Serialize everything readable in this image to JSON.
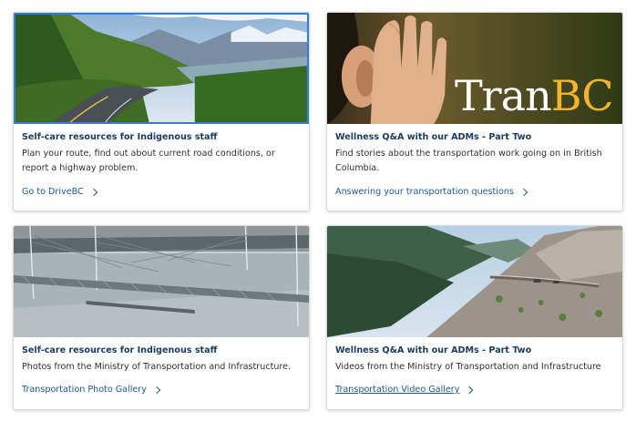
{
  "cards": [
    {
      "title": "Self-care resources for Indigenous staff",
      "description": "Plan your route, find out about current road conditions, or report a highway problem.",
      "link_label": "Go to DriveBC",
      "image": "mountain-highway-photo"
    },
    {
      "title": "Wellness Q&A with our ADMs - Part Two",
      "description": "Find stories about the transportation work going on in British Columbia.",
      "link_label": "Answering your transportation questions",
      "image": "tranbc-ear-photo",
      "logo_text_1": "Tran",
      "logo_text_2": "BC"
    },
    {
      "title": "Self-care resources for Indigenous staff",
      "description": "Photos from the Ministry of Transportation and Infrastructure.",
      "link_label": "Transportation Photo Gallery",
      "image": "bridge-construction-photo"
    },
    {
      "title": "Wellness Q&A with our ADMs - Part Two",
      "description": "Videos from the Ministry of Transportation and Infrastructure",
      "link_label": "Transportation Video Gallery",
      "image": "canyon-highway-photo"
    }
  ],
  "colors": {
    "title": "#1a3a5e",
    "link": "#1a5a96",
    "focus_outline": "#2f7fdc",
    "logo_accent": "#f1b42f"
  }
}
